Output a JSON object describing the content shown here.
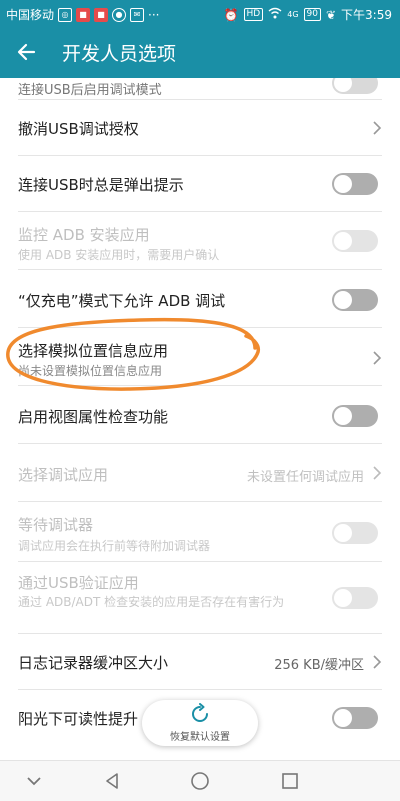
{
  "status_bar": {
    "carrier": "中国移动",
    "more": "···",
    "signal_label": "4G",
    "battery": "90",
    "time": "下午3:59",
    "hd_label": "HD"
  },
  "app_bar": {
    "title": "开发人员选项"
  },
  "rows": [
    {
      "title": "连接USB后启用调试模式"
    },
    {
      "title": "撤消USB调试授权"
    },
    {
      "title": "连接USB时总是弹出提示"
    },
    {
      "title": "监控 ADB 安装应用",
      "subtitle": "使用 ADB 安装应用时，需要用户确认"
    },
    {
      "title": "“仅充电”模式下允许 ADB 调试"
    },
    {
      "title": "选择模拟位置信息应用",
      "subtitle": "尚未设置模拟位置信息应用"
    },
    {
      "title": "启用视图属性检查功能"
    },
    {
      "title": "选择调试应用",
      "value": "未设置任何调试应用"
    },
    {
      "title": "等待调试器",
      "subtitle": "调试应用会在执行前等待附加调试器"
    },
    {
      "title": "通过USB验证应用",
      "subtitle": "通过 ADB/ADT 检查安装的应用是否存在有害行为"
    },
    {
      "title": "日志记录器缓冲区大小",
      "value": "256 KB/缓冲区"
    },
    {
      "title": "阳光下可读性提升"
    }
  ],
  "restore_button": {
    "label": "恢复默认设置"
  },
  "colors": {
    "accent": "#1a8fa6",
    "annotation": "#f08a2e",
    "toggle_off": "#aeaeae"
  }
}
